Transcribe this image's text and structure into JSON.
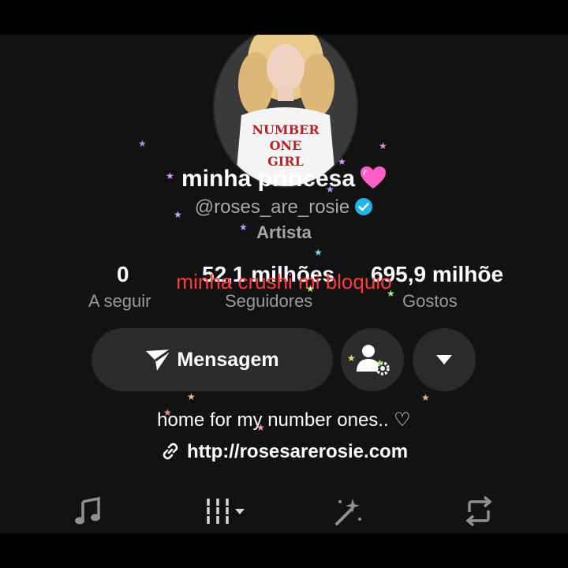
{
  "profile": {
    "display_name": "minha princesa",
    "handle": "@roses_are_rosie",
    "category": "Artista",
    "avatar_shirt_text": [
      "NUMBER",
      "ONE",
      "GIRL"
    ]
  },
  "stats": {
    "following_count": "0",
    "following_label": "A seguir",
    "followers_count": "52,1 milhões",
    "followers_label": "Seguidores",
    "likes_count": "695,9 milhõe",
    "likes_label": "Gostos"
  },
  "overlay_caption": "minha crushi mi bloquio",
  "actions": {
    "message_label": "Mensagem"
  },
  "bio": {
    "text": "home for my number ones.. ♡",
    "link": "http://rosesarerosie.com"
  },
  "tabs": [
    "music-icon",
    "grid-icon",
    "sparkle-icon",
    "repost-icon"
  ],
  "colors": {
    "background": "#121212",
    "button": "#2b2b2b",
    "caption": "#ff3b3b",
    "verified": "#20b5ec",
    "heart": "#ff5fc8"
  }
}
